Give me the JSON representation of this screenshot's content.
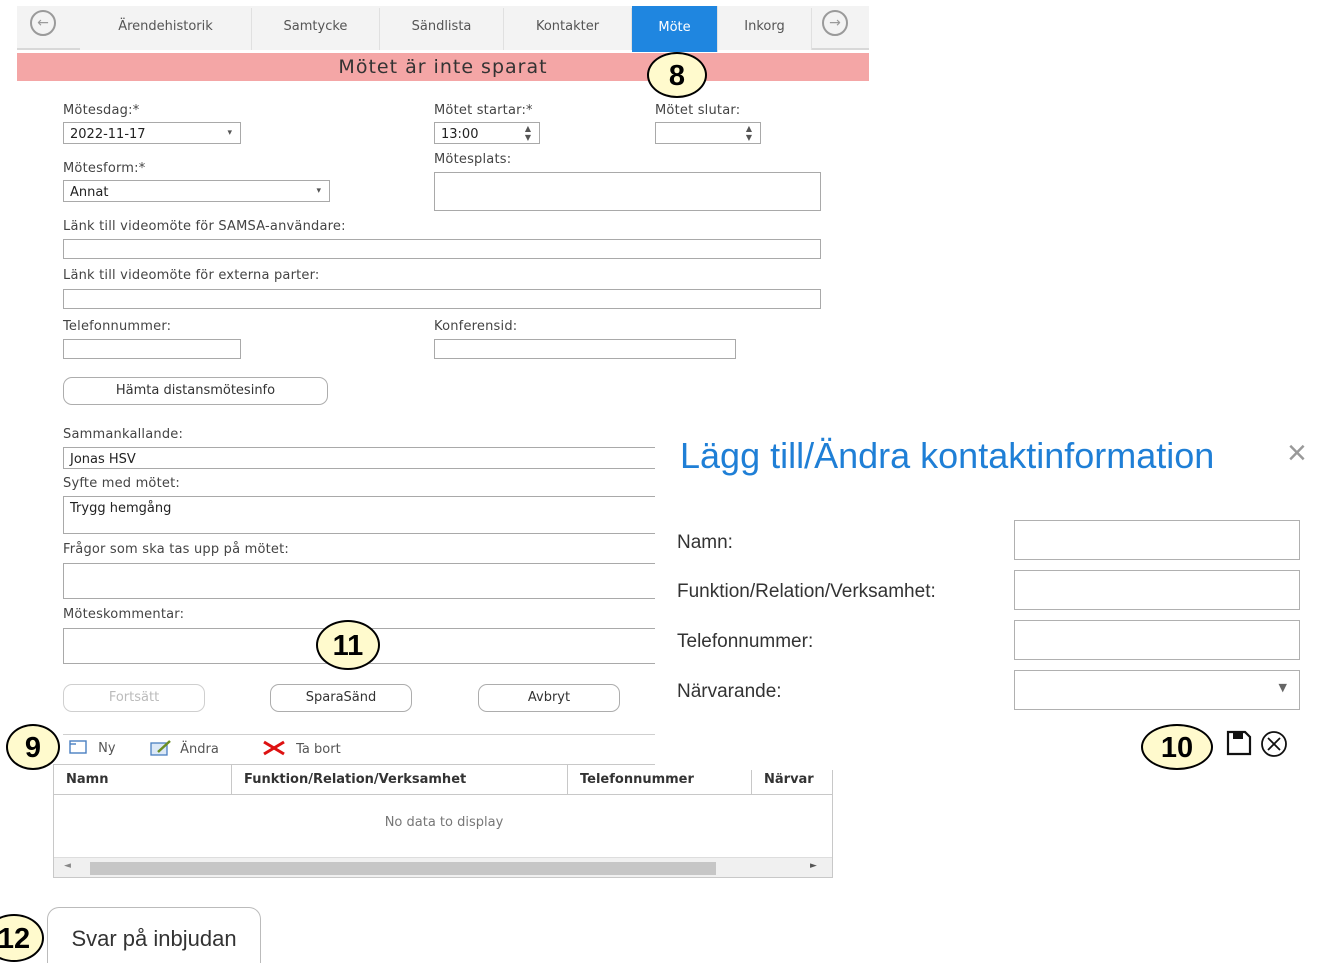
{
  "tabs": {
    "back_arrow": "←",
    "forward_arrow": "→",
    "items": [
      {
        "label": "Ärendehistorik"
      },
      {
        "label": "Samtycke"
      },
      {
        "label": "Sändlista"
      },
      {
        "label": "Kontakter"
      },
      {
        "label": "Möte"
      },
      {
        "label": "Inkorg"
      }
    ]
  },
  "banner": {
    "text": "Mötet är inte sparat",
    "color": "#f4a6a6"
  },
  "form": {
    "motesdag_label": "Mötesdag:*",
    "motesdag_value": "2022-11-17",
    "start_label": "Mötet startar:*",
    "start_value": "13:00",
    "end_label": "Mötet slutar:",
    "end_value": "",
    "motesform_label": "Mötesform:*",
    "motesform_value": "Annat",
    "motesplats_label": "Mötesplats:",
    "motesplats_value": "",
    "samsa_link_label": "Länk till videomöte för SAMSA-användare:",
    "external_link_label": "Länk till videomöte för externa parter:",
    "phone_label": "Telefonnummer:",
    "conference_label": "Konferensid:",
    "fetch_button": "Hämta distansmötesinfo",
    "caller_label": "Sammankallande:",
    "caller_value": "Jonas HSV",
    "purpose_label": "Syfte med mötet:",
    "purpose_value": "Trygg hemgång",
    "questions_label": "Frågor som ska tas upp på mötet:",
    "comment_label": "Möteskommentar:"
  },
  "actions": {
    "continue": "Fortsätt",
    "save_send": "SparaSänd",
    "cancel": "Avbryt"
  },
  "toolbar": {
    "new": "Ny",
    "edit": "Ändra",
    "delete": "Ta bort"
  },
  "table": {
    "headers": [
      "Namn",
      "Funktion/Relation/Verksamhet",
      "Telefonnummer",
      "Närvar"
    ],
    "empty_text": "No data to display"
  },
  "dialog": {
    "title": "Lägg till/Ändra kontaktinformation",
    "close_symbol": "×",
    "name_label": "Namn:",
    "function_label": "Funktion/Relation/Verksamhet:",
    "phone_label": "Telefonnummer:",
    "present_label": "Närvarande:",
    "title_color": "#1f7fd6"
  },
  "bottom_button": "Svar på inbjudan",
  "callouts": {
    "c8": "8",
    "c9": "9",
    "c10": "10",
    "c11": "11",
    "c12": "12"
  },
  "icons": {
    "back": "arrow-left-circle-icon",
    "forward": "arrow-right-circle-icon",
    "new": "new-document-icon",
    "edit": "edit-document-icon",
    "delete": "red-x-icon",
    "save": "floppy-disk-icon",
    "cancel": "circle-x-icon"
  }
}
